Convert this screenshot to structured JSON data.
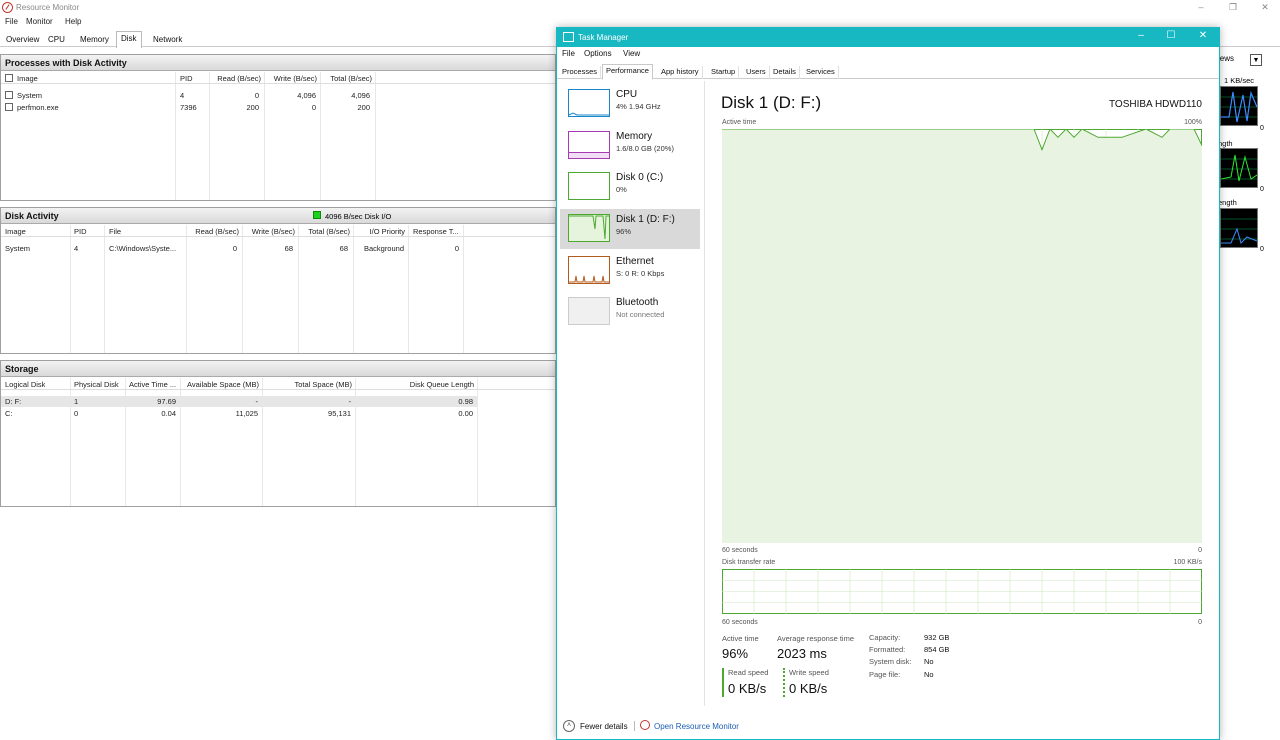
{
  "resource_monitor": {
    "title": "Resource Monitor",
    "menu": [
      "File",
      "Monitor",
      "Help"
    ],
    "tabs": [
      "Overview",
      "CPU",
      "Memory",
      "Disk",
      "Network"
    ],
    "active_tab": "Disk",
    "views_label": "iews",
    "processes": {
      "title": "Processes with Disk Activity",
      "headers": [
        "Image",
        "PID",
        "Read (B/sec)",
        "Write (B/sec)",
        "Total (B/sec)"
      ],
      "rows": [
        [
          "System",
          "4",
          "0",
          "4,096",
          "4,096"
        ],
        [
          "perfmon.exe",
          "7396",
          "200",
          "0",
          "200"
        ]
      ]
    },
    "disk_activity": {
      "title": "Disk Activity",
      "indicator": "4096 B/sec Disk I/O",
      "headers": [
        "Image",
        "PID",
        "File",
        "Read (B/sec)",
        "Write (B/sec)",
        "Total (B/sec)",
        "I/O Priority",
        "Response T..."
      ],
      "rows": [
        [
          "System",
          "4",
          "C:\\Windows\\Syste...",
          "0",
          "68",
          "68",
          "Background",
          "0"
        ]
      ]
    },
    "storage": {
      "title": "Storage",
      "headers": [
        "Logical Disk",
        "Physical Disk",
        "Active Time ...",
        "Available Space (MB)",
        "Total Space (MB)",
        "Disk Queue Length"
      ],
      "rows": [
        [
          "D: F:",
          "1",
          "97.69",
          "-",
          "-",
          "0.98"
        ],
        [
          "C:",
          "0",
          "0.04",
          "11,025",
          "95,131",
          "0.00"
        ]
      ]
    },
    "right_graphs": {
      "label1": "1 KB/sec",
      "label2": "ngth",
      "label3": "ength",
      "zero": "0"
    }
  },
  "task_manager": {
    "title": "Task Manager",
    "menu": [
      "File",
      "Options",
      "View"
    ],
    "tabs": [
      "Processes",
      "Performance",
      "App history",
      "Startup",
      "Users",
      "Details",
      "Services"
    ],
    "active_tab": "Performance",
    "sidebar": [
      {
        "name": "CPU",
        "sub": "4% 1.94 GHz",
        "color": "#1a86c9"
      },
      {
        "name": "Memory",
        "sub": "1.6/8.0 GB (20%)",
        "color": "#a63cb3"
      },
      {
        "name": "Disk 0 (C:)",
        "sub": "0%",
        "color": "#4da832"
      },
      {
        "name": "Disk 1 (D: F:)",
        "sub": "96%",
        "color": "#4da832"
      },
      {
        "name": "Ethernet",
        "sub": "S: 0 R: 0 Kbps",
        "color": "#b35b1e"
      },
      {
        "name": "Bluetooth",
        "sub": "Not connected",
        "color": "#aaaaaa"
      }
    ],
    "selected_index": 3,
    "detail": {
      "title": "Disk 1 (D: F:)",
      "model": "TOSHIBA HDWD110",
      "active_time_label": "Active time",
      "active_time_max": "100%",
      "x_left": "60 seconds",
      "x_right": "0",
      "transfer_label": "Disk transfer rate",
      "transfer_max": "100 KB/s",
      "stats": {
        "active_time_label": "Active time",
        "active_time_value": "96%",
        "avg_resp_label": "Average response time",
        "avg_resp_value": "2023 ms",
        "read_label": "Read speed",
        "read_value": "0 KB/s",
        "write_label": "Write speed",
        "write_value": "0 KB/s"
      },
      "info": [
        {
          "key": "Capacity:",
          "value": "932 GB"
        },
        {
          "key": "Formatted:",
          "value": "854 GB"
        },
        {
          "key": "System disk:",
          "value": "No"
        },
        {
          "key": "Page file:",
          "value": "No"
        }
      ]
    },
    "footer": {
      "fewer": "Fewer details",
      "open_rm": "Open Resource Monitor"
    },
    "accent": "#17b8c2",
    "disk_color": "#4da832"
  },
  "chart_data": {
    "type": "line",
    "x": [
      60,
      57,
      54,
      51,
      48,
      45,
      42,
      39,
      36,
      33,
      30,
      27,
      24,
      21,
      20,
      19,
      18,
      17,
      16,
      15,
      13,
      10,
      7,
      5,
      4,
      3,
      2,
      1,
      0
    ],
    "values": [
      100,
      100,
      100,
      100,
      100,
      100,
      100,
      100,
      100,
      100,
      100,
      100,
      100,
      100,
      95,
      100,
      98,
      100,
      98,
      100,
      98,
      98,
      100,
      98,
      100,
      100,
      100,
      100,
      96
    ],
    "xlabel": "60 seconds",
    "ylabel": "Active time",
    "ylim": [
      0,
      100
    ],
    "grid": true
  }
}
